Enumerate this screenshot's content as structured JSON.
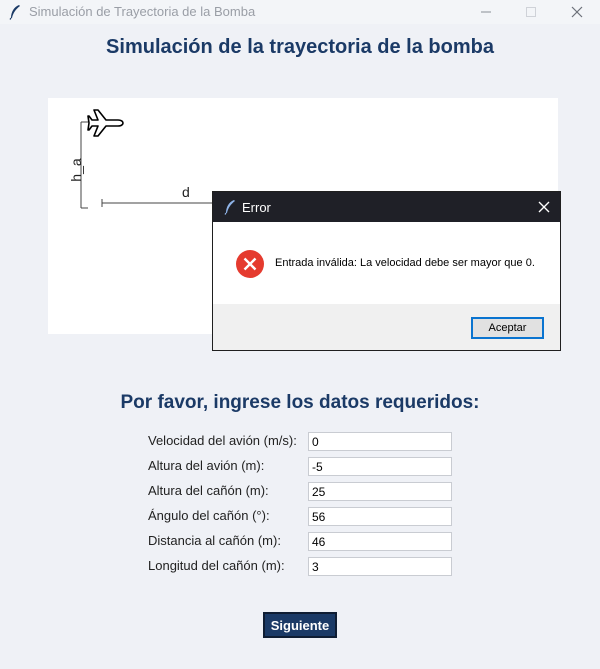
{
  "window": {
    "title": "Simulación de Trayectoria de la Bomba",
    "app_icon": "feather-icon"
  },
  "heading": "Simulación de la trayectoria de la bomba",
  "diagram": {
    "plane_icon": "airplane-icon",
    "height_label": "h_a",
    "distance_label": "d"
  },
  "form": {
    "prompt": "Por favor, ingrese los datos requeridos:",
    "fields": [
      {
        "label": "Velocidad del avión (m/s):",
        "value": "0"
      },
      {
        "label": "Altura del avión (m):",
        "value": "-5"
      },
      {
        "label": "Altura del cañón (m):",
        "value": "25"
      },
      {
        "label": "Ángulo del cañón (°):",
        "value": "56"
      },
      {
        "label": "Distancia al cañón (m):",
        "value": "46"
      },
      {
        "label": "Longitud del cañón (m):",
        "value": "3"
      }
    ],
    "next_label": "Siguiente"
  },
  "dialog": {
    "title": "Error",
    "message": "Entrada inválida: La velocidad debe ser mayor que 0.",
    "ok_label": "Aceptar",
    "icon": "error-icon"
  },
  "colors": {
    "accent": "#1b3a66",
    "background": "#eff1f6",
    "error": "#e53b2f"
  }
}
